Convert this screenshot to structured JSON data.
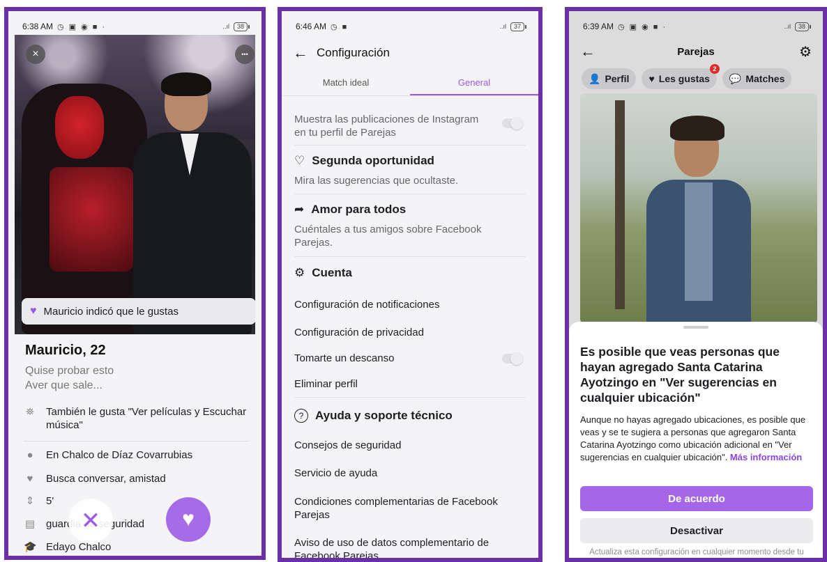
{
  "phone1": {
    "status": {
      "time": "6:38 AM",
      "icons": "◷ ▣ ◉ ■ ·",
      "signal": "..ıl",
      "battery": "38"
    },
    "close_icon": "×",
    "more_icon": "•••",
    "like_banner": "Mauricio indicó que le gustas",
    "name": "Mauricio, 22",
    "bio_line1": "Quise probar esto",
    "bio_line2": "Aver que sale...",
    "rows": [
      {
        "icon": "telescope-icon",
        "glyph": "⛯",
        "text": "También le gusta \"Ver películas y Escuchar música\""
      },
      {
        "icon": "location-pin-icon",
        "glyph": "●",
        "text": "En Chalco de Díaz Covarrubias"
      },
      {
        "icon": "hearts-icon",
        "glyph": "♥",
        "text": "Busca conversar, amistad"
      },
      {
        "icon": "height-icon",
        "glyph": "⇕",
        "text": "5'"
      },
      {
        "icon": "briefcase-icon",
        "glyph": "▤",
        "text": "guardia de seguridad"
      },
      {
        "icon": "graduation-icon",
        "glyph": "🎓",
        "text": "Edayo Chalco"
      }
    ],
    "dislike_icon": "✕",
    "like_icon": "♥"
  },
  "phone2": {
    "status": {
      "time": "6:46 AM",
      "icons": "◷ ■",
      "signal": "..ıl",
      "battery": "37"
    },
    "title": "Configuración",
    "tabs": [
      "Match ideal",
      "General"
    ],
    "instagram_desc": "Muestra las publicaciones de Instagram en tu perfil de Parejas",
    "second_chance_title": "Segunda oportunidad",
    "second_chance_desc": "Mira las sugerencias que ocultaste.",
    "love_all_title": "Amor para todos",
    "love_all_desc": "Cuéntales a tus amigos sobre Facebook Parejas.",
    "account_title": "Cuenta",
    "account_items": [
      "Configuración de notificaciones",
      "Configuración de privacidad",
      "Tomarte un descanso",
      "Eliminar perfil"
    ],
    "help_title": "Ayuda y soporte técnico",
    "help_items": [
      "Consejos de seguridad",
      "Servicio de ayuda",
      "Condiciones complementarias de Facebook Parejas",
      "Aviso de uso de datos complementario de Facebook Parejas"
    ]
  },
  "phone3": {
    "status": {
      "time": "6:39 AM",
      "icons": "◷ ▣ ◉ ■ ·",
      "signal": "..ıl",
      "battery": "38"
    },
    "title": "Parejas",
    "chips": [
      {
        "label": "Perfil",
        "glyph": "👤"
      },
      {
        "label": "Les gustas",
        "glyph": "♥",
        "badge": "2"
      },
      {
        "label": "Matches",
        "glyph": "💬"
      }
    ],
    "sheet_title": "Es posible que veas personas que hayan agregado Santa Catarina Ayotzingo en \"Ver sugerencias en cualquier ubicación\"",
    "sheet_body": "Aunque no hayas agregado ubicaciones, es posible que veas y se te sugiera a personas que agregaron Santa Catarina Ayotzingo como ubicación adicional en \"Ver sugerencias en cualquier ubicación\". ",
    "sheet_link": "Más información",
    "primary_button": "De acuerdo",
    "secondary_button": "Desactivar",
    "footer": "Actualiza esta configuración en cualquier momento desde tu página de ubicación para Parejas."
  },
  "colors": {
    "frame": "#6b2fa8",
    "accent": "#a566ea",
    "link": "#8a45e0"
  }
}
